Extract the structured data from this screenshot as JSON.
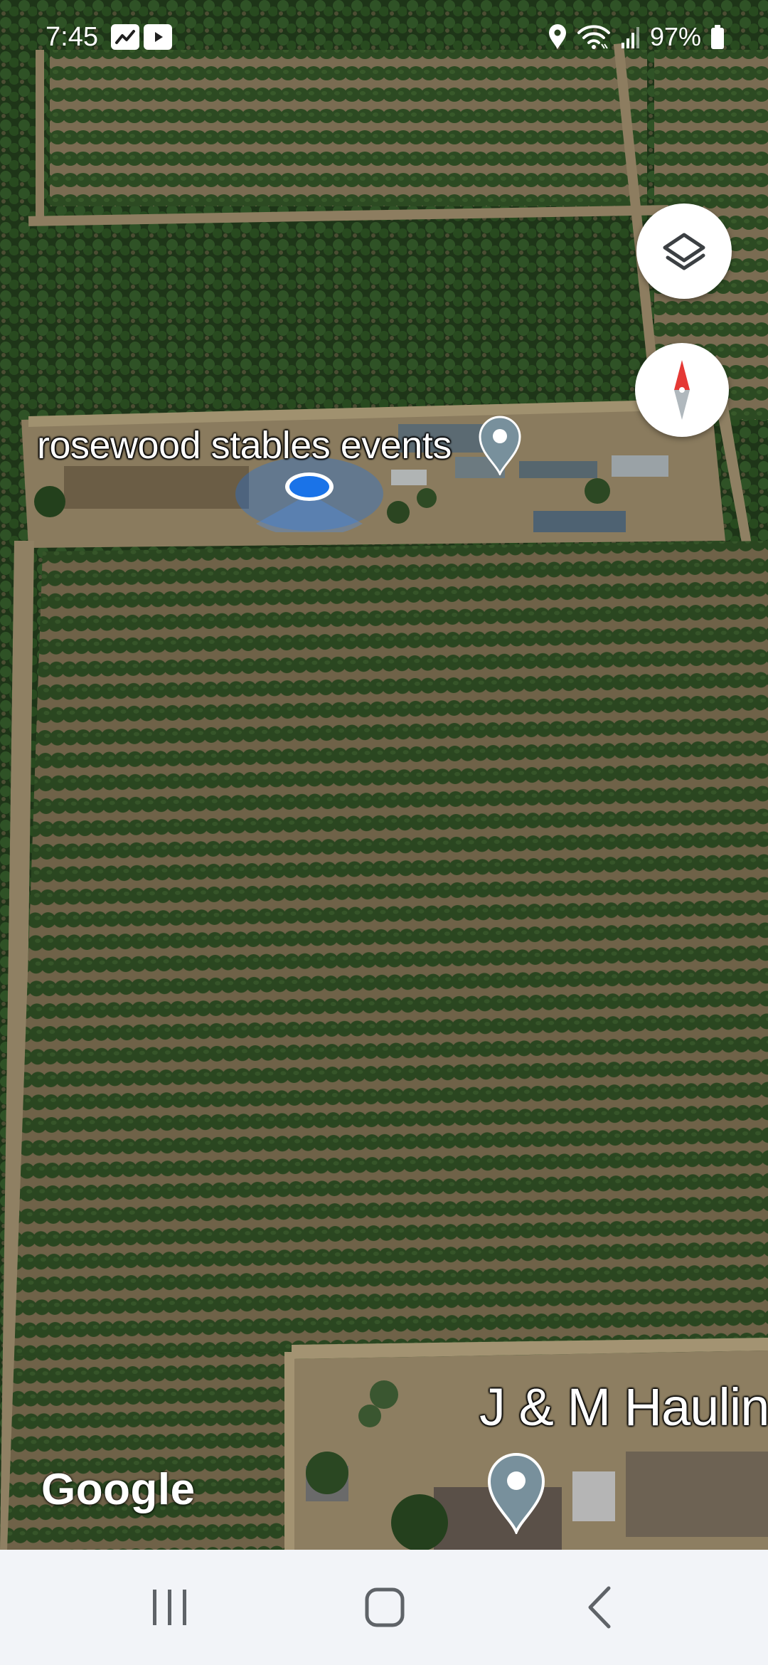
{
  "status_bar": {
    "time": "7:45",
    "app_icons": [
      "stocks-app-icon",
      "youtube-icon"
    ],
    "indicators": [
      "location-icon",
      "wifi-icon",
      "signal-icon"
    ],
    "battery_percent": "97%"
  },
  "map": {
    "view": "satellite",
    "labels": {
      "place_1": "rosewood stables events",
      "place_2": "J & M Haulin"
    },
    "attribution": "Google",
    "controls": {
      "layers_icon": "layers-icon",
      "compass_icon": "compass-icon"
    },
    "colors": {
      "location_blue": "#1a73e8",
      "compass_red": "#e53935",
      "pin_gray": "#78909c"
    }
  },
  "nav_bar": {
    "buttons": [
      "recents-icon",
      "home-icon",
      "back-icon"
    ]
  }
}
